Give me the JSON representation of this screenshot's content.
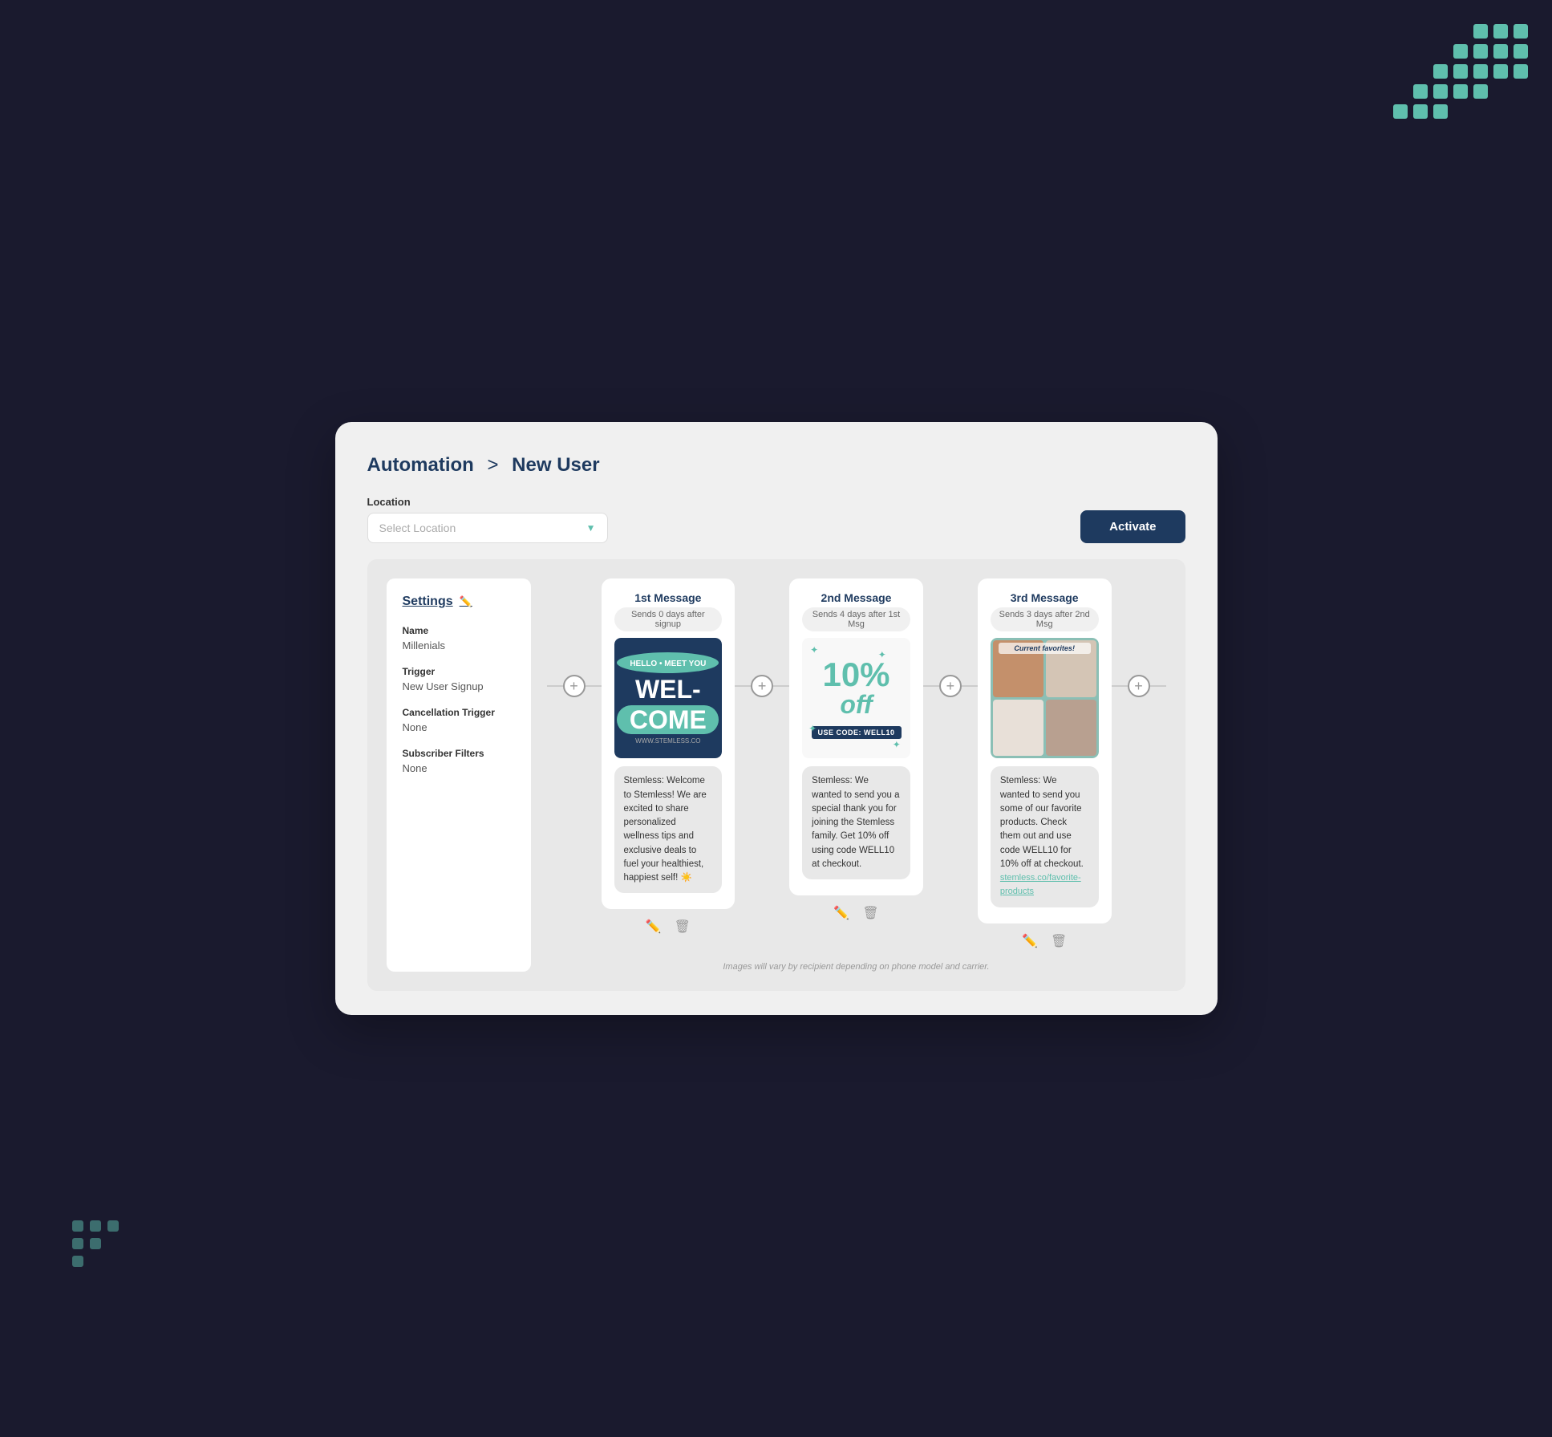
{
  "background": {
    "color": "#1a1a2e"
  },
  "breadcrumb": {
    "parent": "Automation",
    "separator": ">",
    "current": "New User"
  },
  "location": {
    "label": "Location",
    "placeholder": "Select Location",
    "options": []
  },
  "activate_button": {
    "label": "Activate"
  },
  "settings": {
    "title": "Settings",
    "fields": [
      {
        "label": "Name",
        "value": "Millenials"
      },
      {
        "label": "Trigger",
        "value": "New User Signup"
      },
      {
        "label": "Cancellation Trigger",
        "value": "None"
      },
      {
        "label": "Subscriber Filters",
        "value": "None"
      }
    ]
  },
  "messages": [
    {
      "title": "1st Message",
      "subtitle": "Sends 0 days after signup",
      "image_type": "welcome",
      "image_alt": "Welcome image with teal design",
      "welcome_line1": "WEL-",
      "welcome_line2": "COME",
      "body": "Stemless: Welcome to Stemless! We are excited to share personalized wellness tips and exclusive deals to fuel your healthiest, happiest self! ☀️"
    },
    {
      "title": "2nd Message",
      "subtitle": "Sends 4 days after 1st Msg",
      "image_type": "discount",
      "image_alt": "10% off discount image",
      "discount_amount": "10%",
      "discount_off": "off",
      "use_code": "USE CODE: WELL10",
      "body": "Stemless: We wanted to send you a special thank you for joining the Stemless family. Get 10% off using code WELL10 at checkout."
    },
    {
      "title": "3rd Message",
      "subtitle": "Sends 3 days after 2nd Msg",
      "image_type": "favorites",
      "image_alt": "Current favorites product grid",
      "favorites_label": "Current favorites!",
      "body": "Stemless: We wanted to send you some of our favorite products. Check them out and use code WELL10 for 10% off at checkout.",
      "link": "stemless.co/favorite-products"
    }
  ],
  "footer": {
    "note": "Images will vary by recipient depending on phone model and carrier."
  },
  "connector": {
    "symbol": "+"
  }
}
